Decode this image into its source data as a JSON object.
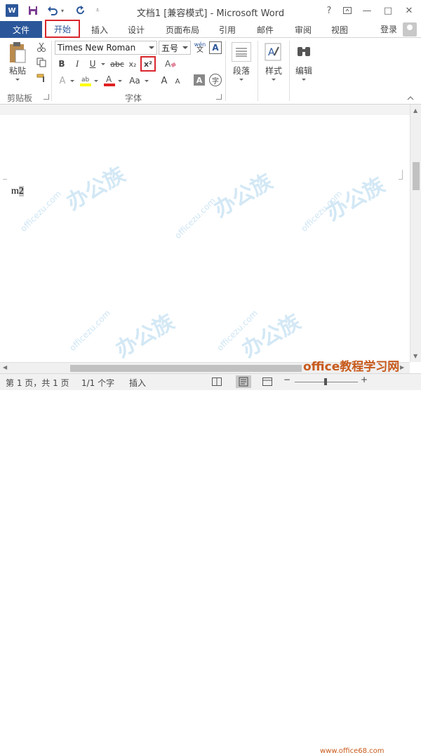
{
  "titlebar": {
    "title": "文档1 [兼容模式] - Microsoft Word",
    "app_icon": "W",
    "help": "?",
    "restore": "⧉",
    "minimize": "—",
    "maximize": "□",
    "close": "✕"
  },
  "tabs": {
    "file": "文件",
    "home": "开始",
    "insert": "插入",
    "design": "设计",
    "layout": "页面布局",
    "references": "引用",
    "mailings": "邮件",
    "review": "审阅",
    "view": "视图",
    "login": "登录"
  },
  "ribbon": {
    "paste_label": "粘贴",
    "clipboard_label": "剪贴板",
    "font_name": "Times New Roman",
    "font_size": "五号",
    "pinyin_label": "wén",
    "font_group_label": "字体",
    "paragraph_label": "段落",
    "styles_label": "样式",
    "editing_label": "编辑",
    "bold": "B",
    "italic": "I",
    "underline": "U",
    "strikethrough": "abc",
    "subscript": "x₂",
    "superscript": "x²",
    "change_case": "Aa",
    "grow_font": "A",
    "shrink_font": "A"
  },
  "document": {
    "text": "m",
    "selected": "2"
  },
  "watermark": {
    "brand": "办公族",
    "url": "officezu.com"
  },
  "statusbar": {
    "page": "第 1 页，共 1 页",
    "words": "1/1 个字",
    "mode": "插入"
  },
  "site": {
    "name": "office教程学习网",
    "url": "www.office68.com"
  },
  "colors": {
    "accent": "#2b579a",
    "highlight_red": "#d9262c"
  }
}
